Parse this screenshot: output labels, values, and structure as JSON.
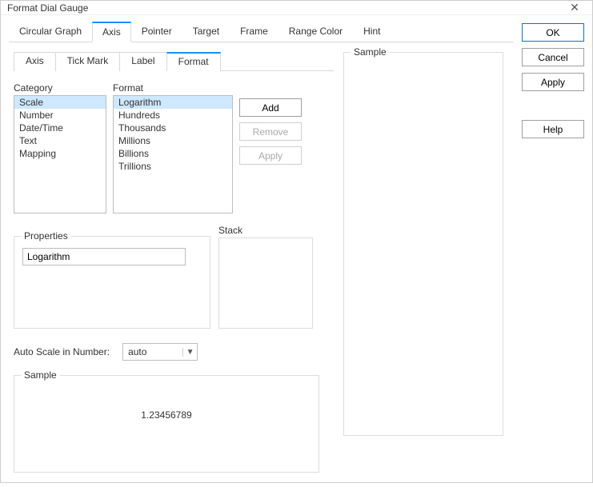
{
  "window": {
    "title": "Format Dial Gauge"
  },
  "topTabs": {
    "items": [
      "Circular Graph",
      "Axis",
      "Pointer",
      "Target",
      "Frame",
      "Range Color",
      "Hint"
    ],
    "active": "Axis"
  },
  "subTabs": {
    "items": [
      "Axis",
      "Tick Mark",
      "Label",
      "Format"
    ],
    "active": "Format"
  },
  "categoryLabel": "Category",
  "formatLabel": "Format",
  "categories": {
    "items": [
      "Scale",
      "Number",
      "Date/Time",
      "Text",
      "Mapping"
    ],
    "selected": "Scale"
  },
  "formats": {
    "items": [
      "Logarithm",
      "Hundreds",
      "Thousands",
      "Millions",
      "Billions",
      "Trillions"
    ],
    "selected": "Logarithm"
  },
  "listButtons": {
    "add": "Add",
    "remove": "Remove",
    "apply": "Apply"
  },
  "properties": {
    "label": "Properties",
    "value": "Logarithm"
  },
  "stack": {
    "label": "Stack"
  },
  "autoScale": {
    "label": "Auto Scale in Number:",
    "value": "auto"
  },
  "sampleLocal": {
    "label": "Sample",
    "value": "1.23456789"
  },
  "sampleRight": {
    "label": "Sample"
  },
  "buttons": {
    "ok": "OK",
    "cancel": "Cancel",
    "apply": "Apply",
    "help": "Help"
  }
}
